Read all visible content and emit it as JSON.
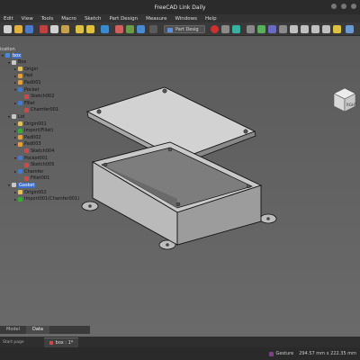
{
  "window": {
    "title": "FreeCAD Link Daily"
  },
  "menu": [
    "Edit",
    "View",
    "Tools",
    "Macro",
    "Sketch",
    "Part Design",
    "Measure",
    "Windows",
    "Help"
  ],
  "toolbar": {
    "workbench": "Part Desig"
  },
  "tree": {
    "header": "ication",
    "rows": [
      {
        "label": "box",
        "indent": 1,
        "color": "#4f87d8",
        "exp": "▾",
        "selected": true
      },
      {
        "label": "Box",
        "indent": 2,
        "color": "#c8c8c8",
        "exp": "▾"
      },
      {
        "label": "Origin",
        "indent": 3,
        "color": "#e0c060",
        "exp": "▸"
      },
      {
        "label": "Pad",
        "indent": 3,
        "color": "#e0a040",
        "exp": "▸"
      },
      {
        "label": "Pad001",
        "indent": 3,
        "color": "#e0a040",
        "exp": "▸"
      },
      {
        "label": "Pocket",
        "indent": 3,
        "color": "#4878c8",
        "exp": "▾"
      },
      {
        "label": "Sketch002",
        "indent": 4,
        "color": "#d04848",
        "exp": ""
      },
      {
        "label": "Fillet",
        "indent": 3,
        "color": "#4878c8",
        "exp": "▸"
      },
      {
        "label": "Chamfer001",
        "indent": 4,
        "color": "#d04848",
        "exp": ""
      },
      {
        "label": "Lid",
        "indent": 2,
        "color": "#c8c8c8",
        "exp": "▾"
      },
      {
        "label": "Origin001",
        "indent": 3,
        "color": "#e0c060",
        "exp": "▸"
      },
      {
        "label": "Import(Fillet)",
        "indent": 3,
        "color": "#38a838",
        "exp": "▸"
      },
      {
        "label": "Pad002",
        "indent": 3,
        "color": "#e0a040",
        "exp": "▸"
      },
      {
        "label": "Pad003",
        "indent": 3,
        "color": "#e0a040",
        "exp": "▾"
      },
      {
        "label": "Sketch004",
        "indent": 4,
        "color": "#d04848",
        "exp": ""
      },
      {
        "label": "Pocket001",
        "indent": 3,
        "color": "#4878c8",
        "exp": "▾"
      },
      {
        "label": "Sketch005",
        "indent": 4,
        "color": "#d04848",
        "exp": ""
      },
      {
        "label": "Chamfer",
        "indent": 3,
        "color": "#4878c8",
        "exp": "▸"
      },
      {
        "label": "Fillet001",
        "indent": 4,
        "color": "#d04848",
        "exp": ""
      },
      {
        "label": "Gasket",
        "indent": 2,
        "color": "#c8c8c8",
        "exp": "▾",
        "selected": true
      },
      {
        "label": "Origin002",
        "indent": 3,
        "color": "#e0c060",
        "exp": "▸"
      },
      {
        "label": "Import001(Chamfer001)",
        "indent": 3,
        "color": "#38a838",
        "exp": "▸"
      }
    ]
  },
  "panel_tabs": {
    "model": "Model",
    "data": "Data"
  },
  "doc_tabs": {
    "start": "Start page",
    "active": "box : 1*"
  },
  "status": {
    "nav_style": "Gesture",
    "dimensions": "294.57 mm x 222.35 mm"
  },
  "colors": {
    "accent": "#3e6fc8",
    "selected_text": "#ffffff"
  }
}
